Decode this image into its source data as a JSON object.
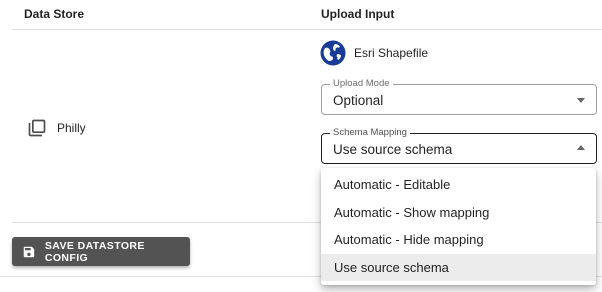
{
  "table": {
    "headers": {
      "data_store": "Data Store",
      "upload_input": "Upload Input"
    },
    "row": {
      "store_icon": "library-books-icon",
      "store_name": "Philly",
      "format_icon": "globe-icon",
      "format_name": "Esri Shapefile",
      "upload_mode": {
        "label": "Upload Mode",
        "value": "Optional"
      },
      "schema_mapping": {
        "label": "Schema Mapping",
        "value": "Use source schema",
        "expanded": true
      }
    }
  },
  "dropdown": {
    "options": [
      "Automatic - Editable",
      "Automatic - Show mapping",
      "Automatic - Hide mapping",
      "Use source schema"
    ],
    "selected_index": 3
  },
  "footer": {
    "save_icon": "save-icon",
    "save_label": "SAVE DATASTORE CONFIG"
  },
  "colors": {
    "button_bg": "#535353",
    "globe_blue": "#1a3c96",
    "selected_bg": "#ececec",
    "divider": "#e0e0e0"
  }
}
